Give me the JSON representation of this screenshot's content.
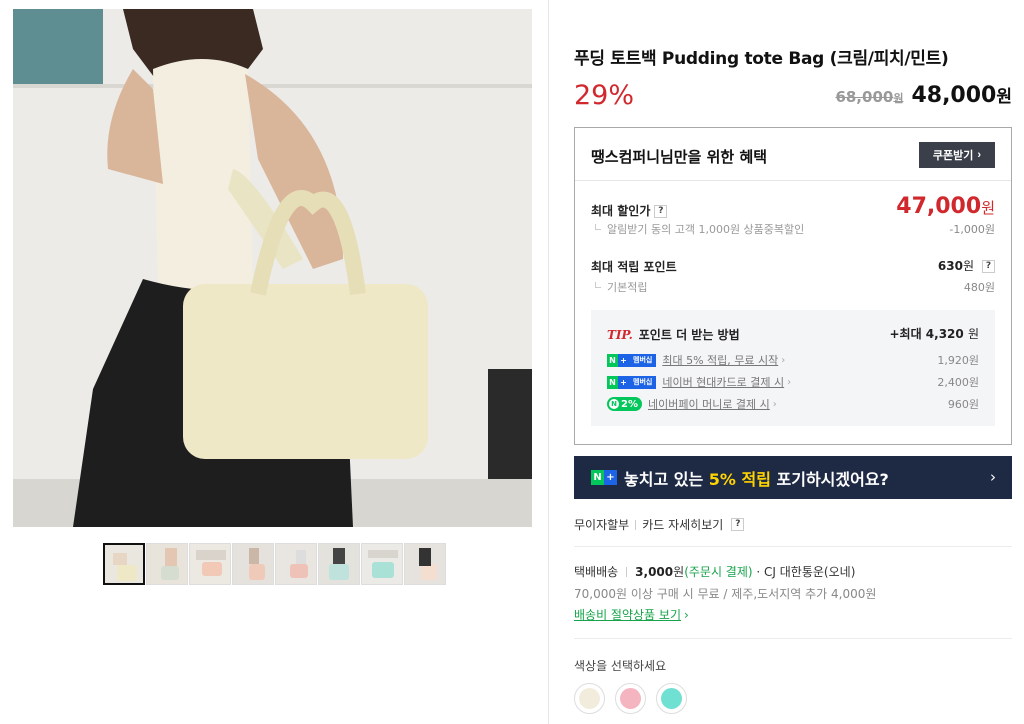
{
  "product": {
    "title": "푸딩 토트백 Pudding tote Bag (크림/피치/민트)",
    "discount_rate": "29%",
    "original_price": "68,000",
    "original_won": "원",
    "sale_price": "48,000",
    "sale_won": "원"
  },
  "benefit": {
    "title": "땡스컴퍼니님만을 위한 혜택",
    "coupon_button": "쿠폰받기",
    "max_discount_label": "최대 할인가",
    "max_discount_price": "47,000",
    "max_discount_won": "원",
    "discount_sub_label": "알림받기 동의 고객 1,000원 상품중복할인",
    "discount_sub_value": "-1,000원",
    "max_point_label": "최대 적립 포인트",
    "max_point_value": "630",
    "max_point_won": "원",
    "basic_point_label": "기본적립",
    "basic_point_value": "480원",
    "help_mark": "?"
  },
  "tip": {
    "tip_word": "TIP.",
    "title": "포인트 더 받는 방법",
    "max": "+최대 4,320",
    "max_won": "원",
    "rows": [
      {
        "badge": "멤버십",
        "text": "최대 5% 적립, 무료 시작",
        "amount": "1,920원"
      },
      {
        "badge": "멤버십",
        "text": "네이버 현대카드로 결제 시",
        "amount": "2,400원"
      },
      {
        "badge": "2%",
        "text": "네이버페이 머니로 결제 시",
        "amount": "960원"
      }
    ]
  },
  "banner": {
    "text_before": "놓치고 있는 ",
    "highlight": "5% 적립",
    "text_after": " 포기하시겠어요?"
  },
  "installment": {
    "label": "무이자할부",
    "detail": "카드 자세히보기"
  },
  "shipping": {
    "type": "택배배송",
    "fee": "3,000",
    "fee_won": "원",
    "pay_note": "(주문시 결제)",
    "carrier": "· CJ 대한통운(오네)",
    "condition": "70,000원 이상 구매 시 무료 / 제주,도서지역 추가 4,000원",
    "save_link": "배송비 절약상품 보기"
  },
  "options": {
    "color_label": "색상을 선택하세요",
    "swatches": [
      "#f2ecdc",
      "#f4b5c0",
      "#6fe0d2"
    ]
  },
  "icons": {
    "arrow": "›",
    "naver_n": "N",
    "plus": "+",
    "np_n": "N"
  }
}
